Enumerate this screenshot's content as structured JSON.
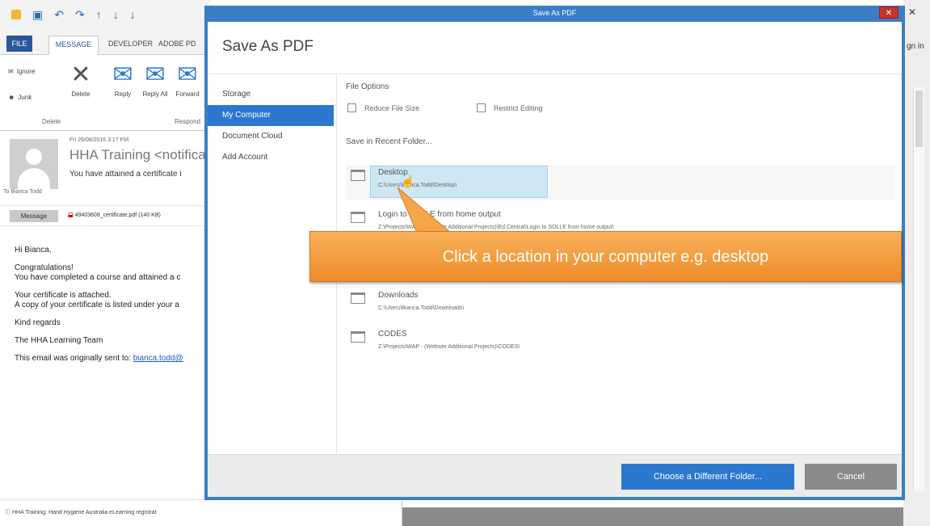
{
  "outlook": {
    "ribbon_tabs": [
      "FILE",
      "MESSAGE",
      "DEVELOPER",
      "ADOBE PD"
    ],
    "ribbon": {
      "ignore": "Ignore",
      "junk": "Junk",
      "delete": "Delete",
      "reply": "Reply",
      "reply_all": "Reply All",
      "forward": "Forward",
      "group_delete": "Delete",
      "group_respond": "Respond"
    },
    "message": {
      "date": "Fri 26/08/2016 3:17 PM",
      "sender": "HHA Training <notificat",
      "subject": "You have attained a certificate i",
      "to": "To  Bianca Todd",
      "message_tab": "Message",
      "attachment": "49403608_certificate.pdf (140 KB)"
    },
    "body": {
      "greeting": "Hi Bianca,",
      "line1": "Congratulations!",
      "line2": "You have completed a course and attained a c",
      "line3": "Your certificate is attached.",
      "line4": "A copy of your certificate is listed under your a",
      "line5": "Kind regards",
      "line6": "The HHA Learning Team",
      "line7_prefix": "This email was originally sent to:",
      "line7_link": "bianca.todd@"
    },
    "status_bar": "HHA Training: Hand Hygiene Australia eLearning registrat",
    "right_edge_text": "gn in"
  },
  "dialog": {
    "window_title": "Save As PDF",
    "heading": "Save As PDF",
    "nav": [
      "Storage",
      "My Computer",
      "Document Cloud",
      "Add Account"
    ],
    "file_options_label": "File Options",
    "reduce_file_size": "Reduce File Size",
    "restrict_editing": "Restrict Editing",
    "recent_folder_label": "Save in Recent Folder...",
    "folders": [
      {
        "name": "Desktop",
        "path": "C:\\Users\\Bianca.Todd\\Desktop\\"
      },
      {
        "name": "Login to SOLLE from home output",
        "path": "Z:\\Projects\\WAP - (Website Additional Projects)\\Ed Central\\Login to SOLLE from home output\\"
      },
      {
        "name": "Downloads",
        "path": "C:\\Users\\Bianca.Todd\\Downloads\\"
      },
      {
        "name": "CODES",
        "path": "Z:\\Projects\\WAP - (Website Additional Projects)\\CODES\\"
      }
    ],
    "choose_folder_button": "Choose a Different Folder...",
    "cancel_button": "Cancel"
  },
  "callout": {
    "text": "Click a location in your computer e.g. desktop"
  },
  "colors": {
    "dialog_border": "#3c7ec5",
    "accent_blue": "#2c78cf",
    "callout_orange": "#f29a3c",
    "close_red": "#c7342b"
  }
}
